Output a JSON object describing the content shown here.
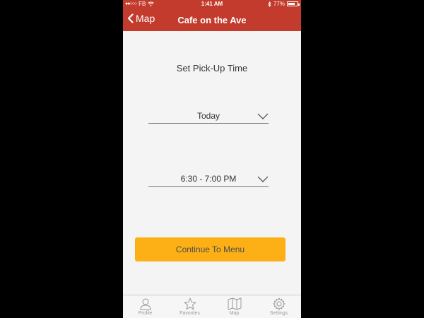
{
  "statusbar": {
    "carrier": "FB",
    "time": "1:41 AM",
    "battery": "77%",
    "battery_level": 0.77
  },
  "navbar": {
    "back_label": "Map",
    "title": "Cafe on the Ave"
  },
  "main": {
    "heading": "Set Pick-Up Time",
    "day_value": "Today",
    "time_value": "6:30 - 7:00 PM",
    "continue_label": "Continue To Menu"
  },
  "tabs": [
    {
      "label": "Profile",
      "icon": "person-icon"
    },
    {
      "label": "Favorites",
      "icon": "star-icon"
    },
    {
      "label": "Map",
      "icon": "map-icon"
    },
    {
      "label": "Settings",
      "icon": "gear-icon"
    }
  ],
  "colors": {
    "header": "#c23b2c",
    "button": "#fdb016",
    "background": "#f4f4f4"
  }
}
